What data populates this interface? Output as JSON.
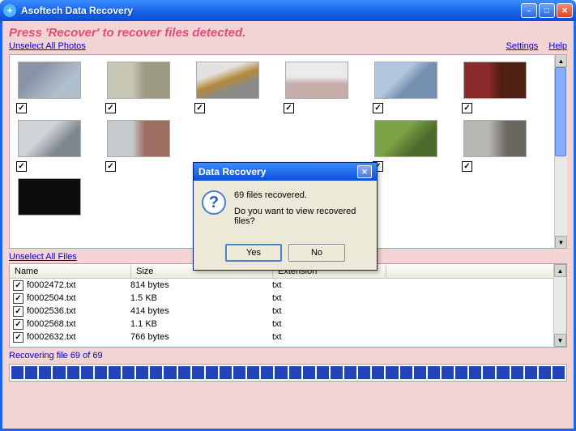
{
  "window": {
    "title": "Asoftech Data Recovery"
  },
  "instructions": "Press 'Recover' to recover files detected.",
  "links": {
    "unselectPhotos": "Unselect All Photos",
    "unselectFiles": "Unselect All Files",
    "settings": "Settings",
    "help": "Help"
  },
  "dialog": {
    "title": "Data Recovery",
    "line1": "69 files recovered.",
    "line2": "Do you want to view recovered files?",
    "yes": "Yes",
    "no": "No"
  },
  "fileTable": {
    "headers": {
      "name": "Name",
      "size": "Size",
      "ext": "Extension"
    },
    "rows": [
      {
        "name": "f0002472.txt",
        "size": "814 bytes",
        "ext": "txt"
      },
      {
        "name": "f0002504.txt",
        "size": "1.5 KB",
        "ext": "txt"
      },
      {
        "name": "f0002536.txt",
        "size": "414 bytes",
        "ext": "txt"
      },
      {
        "name": "f0002568.txt",
        "size": "1.1 KB",
        "ext": "txt"
      },
      {
        "name": "f0002632.txt",
        "size": "766 bytes",
        "ext": "txt"
      }
    ]
  },
  "status": "Recovering file 69 of 69"
}
